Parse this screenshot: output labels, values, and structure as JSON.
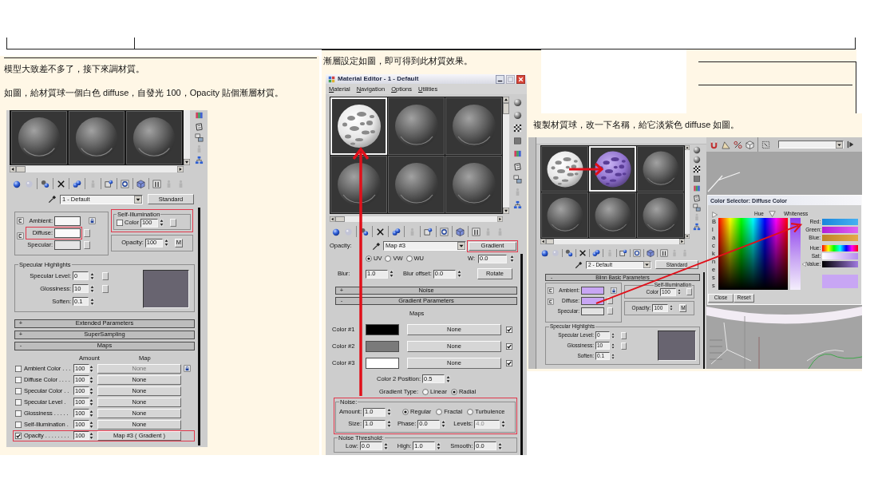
{
  "left_column": {
    "paragraphs": [
      "模型大致差不多了，接下來調材質。",
      "如圖，給材質球一個白色 diffuse，自發光 100，Opacity 貼個漸層材質。"
    ],
    "editor": {
      "sample_slots": [
        {
          "kind": "plain",
          "selected": false
        },
        {
          "kind": "plain",
          "selected": false
        },
        {
          "kind": "plain",
          "selected": false
        }
      ],
      "material_name": "1 - Default",
      "material_type": "Standard",
      "color_rows": [
        {
          "label": "Ambient:",
          "color": "#f6f6f6",
          "highlighted": false
        },
        {
          "label": "Diffuse:",
          "color": "#fafafa",
          "highlighted": true
        },
        {
          "label": "Specular:",
          "color": "#e4e4e4",
          "highlighted": false
        }
      ],
      "self_illumination": {
        "title": "Self-Illumination",
        "checkbox_label": "Color",
        "checked": false,
        "value": "100",
        "highlighted": true
      },
      "opacity": {
        "label": "Opacity:",
        "value": "100",
        "button": "M"
      },
      "specular_highlights": {
        "title": "Specular Highlights",
        "fields": [
          {
            "label": "Specular Level:",
            "value": "0"
          },
          {
            "label": "Glossiness:",
            "value": "10"
          },
          {
            "label": "Soften:",
            "value": "0.1"
          }
        ]
      },
      "rollouts": [
        {
          "sign": "+",
          "title": "Extended Parameters"
        },
        {
          "sign": "+",
          "title": "SuperSampling"
        },
        {
          "sign": "-",
          "title": "Maps"
        }
      ],
      "maps": {
        "amount_header": "Amount",
        "map_header": "Map",
        "rows": [
          {
            "label": "Ambient Color . . .",
            "checked": false,
            "amount": "100",
            "map": "None",
            "disabled": true,
            "highlighted": false
          },
          {
            "label": "Diffuse Color . . . .",
            "checked": false,
            "amount": "100",
            "map": "None",
            "disabled": false,
            "highlighted": false
          },
          {
            "label": "Specular Color . .",
            "checked": false,
            "amount": "100",
            "map": "None",
            "disabled": false,
            "highlighted": false
          },
          {
            "label": "Specular Level .",
            "checked": false,
            "amount": "100",
            "map": "None",
            "disabled": false,
            "highlighted": false
          },
          {
            "label": "Glossiness . . . . .",
            "checked": false,
            "amount": "100",
            "map": "None",
            "disabled": false,
            "highlighted": false
          },
          {
            "label": "Self-Illumination .",
            "checked": false,
            "amount": "100",
            "map": "None",
            "disabled": false,
            "highlighted": false
          },
          {
            "label": "Opacity . . . . . . . .",
            "checked": true,
            "amount": "100",
            "map": "Map #3 ( Gradient )",
            "disabled": false,
            "highlighted": true
          }
        ]
      }
    }
  },
  "middle_column": {
    "paragraphs": [
      "漸層設定如圖，即可得到此材質效果。"
    ],
    "editor": {
      "title": "Material Editor - 1 - Default",
      "menu": [
        "Material",
        "Navigation",
        "Options",
        "Utilities"
      ],
      "sample_slots": [
        {
          "kind": "noise_white",
          "selected": true
        },
        {
          "kind": "plain",
          "selected": false
        },
        {
          "kind": "plain",
          "selected": false
        },
        {
          "kind": "plain",
          "selected": false
        },
        {
          "kind": "plain",
          "selected": false
        },
        {
          "kind": "plain",
          "selected": false
        }
      ],
      "map_slot_label": "Opacity:",
      "map_name": "Map #3",
      "map_type": {
        "label": "Gradient",
        "highlighted": true
      },
      "coordinates": {
        "axes": [
          {
            "label": "UV",
            "selected": true
          },
          {
            "label": "VW",
            "selected": false
          },
          {
            "label": "WU",
            "selected": false
          }
        ],
        "w_label": "W:",
        "w_value": "0.0",
        "blur_label": "Blur:",
        "blur_value": "1.0",
        "blur_offset_label": "Blur offset:",
        "blur_offset_value": "0.0",
        "rotate_button": "Rotate"
      },
      "rollouts": [
        {
          "sign": "+",
          "title": "Noise"
        },
        {
          "sign": "-",
          "title": "Gradient Parameters"
        }
      ],
      "gradient": {
        "maps_header": "Maps",
        "colors": [
          {
            "label": "Color #1",
            "color": "#000000",
            "map": "None",
            "checked": true
          },
          {
            "label": "Color #2",
            "color": "#7a7a7a",
            "map": "None",
            "checked": true
          },
          {
            "label": "Color #3",
            "color": "#ffffff",
            "map": "None",
            "checked": true
          }
        ],
        "position_label": "Color 2 Position:",
        "position_value": "0.5",
        "type_label": "Gradient Type:",
        "types": [
          {
            "label": "Linear",
            "selected": false
          },
          {
            "label": "Radial",
            "selected": true
          }
        ]
      },
      "noise": {
        "title": "Noise:",
        "highlighted": true,
        "amount_label": "Amount:",
        "amount_value": "1.0",
        "types": [
          {
            "label": "Regular",
            "selected": true
          },
          {
            "label": "Fractal",
            "selected": false
          },
          {
            "label": "Turbulence",
            "selected": false
          }
        ],
        "size_label": "Size:",
        "size_value": "1.0",
        "phase_label": "Phase:",
        "phase_value": "0.0",
        "levels_label": "Levels:",
        "levels_value": "4.0",
        "levels_disabled": true
      },
      "noise_threshold": {
        "title": "Noise Threshold:",
        "fields": [
          {
            "label": "Low:",
            "value": "0.0"
          },
          {
            "label": "High:",
            "value": "1.0"
          },
          {
            "label": "Smooth:",
            "value": "0.0"
          }
        ]
      }
    }
  },
  "right_column": {
    "paragraphs": [
      "複製材質球，改一下名稱，給它淡紫色 diffuse 如圖。"
    ],
    "editor": {
      "sample_slots": [
        {
          "kind": "noise_white",
          "selected": false
        },
        {
          "kind": "noise_purple",
          "selected": true
        },
        {
          "kind": "plain",
          "selected": false
        },
        {
          "kind": "plain",
          "selected": false
        },
        {
          "kind": "plain",
          "selected": false
        },
        {
          "kind": "plain",
          "selected": false
        }
      ],
      "material_name": "2 - Default",
      "material_type": "Standard",
      "rollout": {
        "sign": "-",
        "title": "Blinn Basic Parameters"
      },
      "color_rows": [
        {
          "label": "Ambient:",
          "color": "#c8a6f4"
        },
        {
          "label": "Diffuse:",
          "color": "#c8a6f4"
        },
        {
          "label": "Specular:",
          "color": "#e2e2e2"
        }
      ],
      "self_illumination": {
        "title": "Self-Illumination",
        "color_label": "Color",
        "value": "100"
      },
      "opacity": {
        "label": "Opacity:",
        "value": "100",
        "button": "M"
      },
      "specular_highlights": {
        "title": "Specular Highlights",
        "fields": [
          {
            "label": "Specular Level:",
            "value": "0"
          },
          {
            "label": "Glossiness:",
            "value": "10"
          },
          {
            "label": "Soften:",
            "value": "0.1"
          }
        ]
      }
    },
    "color_selector": {
      "title": "Color Selector: Diffuse Color",
      "hue_label": "Hue",
      "whiteness_label": "Whiteness",
      "blackness_label": "Blackness",
      "channels": [
        {
          "label": "Red:",
          "kind": "red"
        },
        {
          "label": "Green:",
          "kind": "green"
        },
        {
          "label": "Blue:",
          "kind": "blue"
        },
        {
          "label": "Hue:",
          "kind": "hue"
        },
        {
          "label": "Sat:",
          "kind": "sat"
        },
        {
          "label": "Value:",
          "kind": "value"
        }
      ],
      "color": "#c8a6f4",
      "close_button": "Close",
      "reset_button": "Reset"
    }
  }
}
